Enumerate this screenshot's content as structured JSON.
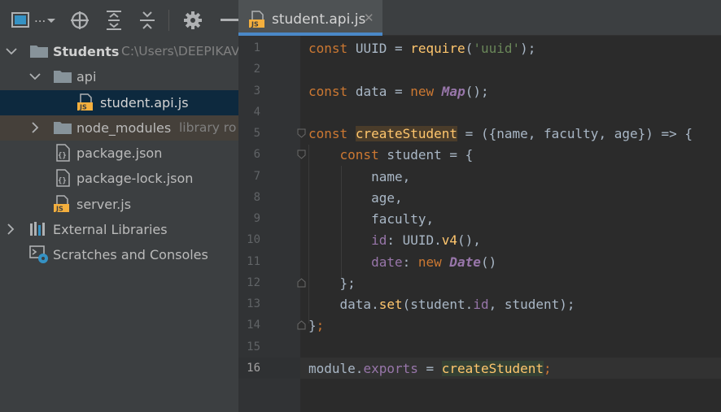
{
  "project": {
    "toolbar": {
      "view_menu_label": "...",
      "icons": [
        "project-view-icon",
        "locate-icon",
        "expand-all-icon",
        "collapse-all-icon",
        "settings-icon",
        "hide-icon"
      ]
    },
    "tree": [
      {
        "label": "Students",
        "path": "C:\\Users\\DEEPIKAV",
        "expanded": true
      },
      {
        "label": "api",
        "expanded": true
      },
      {
        "label": "student.api.js",
        "selected": true
      },
      {
        "label": "node_modules",
        "suffix": "library ro",
        "expanded": false
      },
      {
        "label": "package.json"
      },
      {
        "label": "package-lock.json"
      },
      {
        "label": "server.js"
      },
      {
        "label": "External Libraries",
        "expanded": false
      },
      {
        "label": "Scratches and Consoles"
      }
    ]
  },
  "editor": {
    "tab": {
      "label": "student.api.js",
      "close": "✕",
      "icon_text": "JS"
    },
    "current_line": 16,
    "line_numbers": [
      "1",
      "2",
      "3",
      "4",
      "5",
      "6",
      "7",
      "8",
      "9",
      "10",
      "11",
      "12",
      "13",
      "14",
      "15",
      "16"
    ],
    "code": {
      "l1": {
        "kw": "const",
        "name": "UUID",
        "op": " = ",
        "fn": "require",
        "p1": "(",
        "str": "'uuid'",
        "p2": ");"
      },
      "l3": {
        "kw": "const",
        "name": "data",
        "op": " = ",
        "kw2": "new",
        "cls": "Map",
        "p": "();"
      },
      "l5": {
        "kw": "const",
        "fn": "createStudent",
        "rest": " = ({name, faculty, age}) => {"
      },
      "l6": {
        "kw": "const",
        "rest": " student = {"
      },
      "l7": "name,",
      "l8": "age,",
      "l9": "faculty,",
      "l10": {
        "prop": "id",
        "colon": ": UUID.",
        "fn": "v4",
        "rest": "(),"
      },
      "l11": {
        "prop": "date",
        "colon": ": ",
        "kw": "new",
        "cls": "Date",
        "rest": "()"
      },
      "l12": "};",
      "l13": {
        "obj": "data.",
        "fn": "set",
        "p1": "(student.",
        "prop": "id",
        "p2": ", student);"
      },
      "l14": {
        "brace": "}",
        "semi": ";"
      },
      "l16": {
        "obj": "module.",
        "prop": "exports",
        "op": " = ",
        "fn": "createStudent",
        "semi": ";"
      }
    }
  },
  "colors": {
    "panel": "#3c3f41",
    "editor_bg": "#2b2b2b",
    "keyword": "#cc7832",
    "function": "#ffc66d",
    "string": "#6a8759",
    "property": "#9876aa",
    "selection": "#0d293e"
  }
}
